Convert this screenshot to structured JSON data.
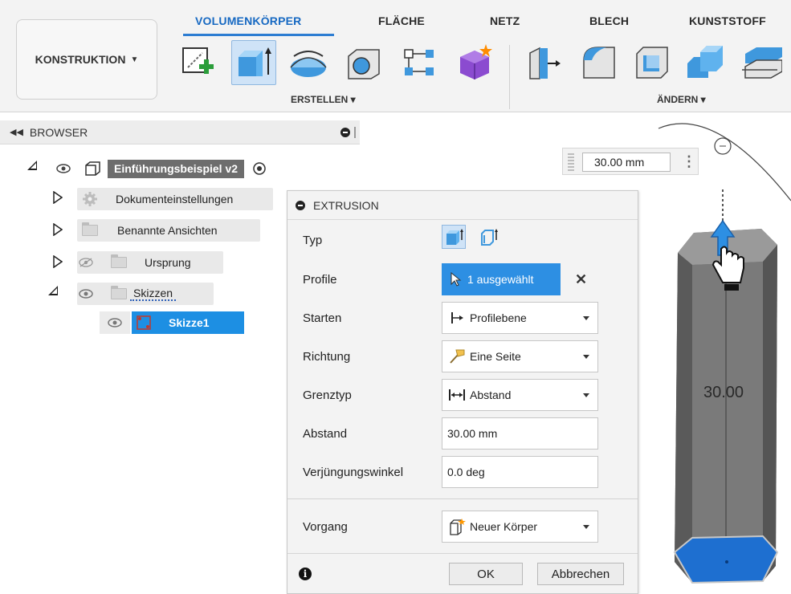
{
  "toolbar": {
    "workspace": "KONSTRUKTION",
    "tabs": [
      "VOLUMENKÖRPER",
      "FLÄCHE",
      "NETZ",
      "BLECH",
      "KUNSTSTOFF"
    ],
    "active_tab": "VOLUMENKÖRPER",
    "groups": {
      "create": "ERSTELLEN",
      "modify": "ÄNDERN"
    },
    "accent": "#1769c2"
  },
  "browser": {
    "title": "BROWSER",
    "root": "Einführungsbeispiel v2",
    "items": [
      {
        "label": "Dokumenteinstellungen",
        "icon": "gear-icon"
      },
      {
        "label": "Benannte Ansichten",
        "icon": "folder-icon"
      },
      {
        "label": "Ursprung",
        "icon": "folder-icon"
      },
      {
        "label": "Skizzen",
        "icon": "folder-icon"
      },
      {
        "label": "Skizze1",
        "icon": "sketch-icon"
      }
    ]
  },
  "dimension": {
    "value": "30.00 mm"
  },
  "extrusion": {
    "title": "EXTRUSION",
    "rows": {
      "typ": "Typ",
      "profile": "Profile",
      "starten": "Starten",
      "richtung": "Richtung",
      "grenztyp": "Grenztyp",
      "abstand": "Abstand",
      "winkel": "Verjüngungswinkel",
      "vorgang": "Vorgang"
    },
    "values": {
      "profile": "1 ausgewählt",
      "starten": "Profilebene",
      "richtung": "Eine Seite",
      "grenztyp": "Abstand",
      "abstand": "30.00 mm",
      "winkel": "0.0 deg",
      "vorgang": "Neuer Körper"
    },
    "buttons": {
      "ok": "OK",
      "cancel": "Abbrechen"
    }
  },
  "viewport": {
    "label": "30.00"
  }
}
